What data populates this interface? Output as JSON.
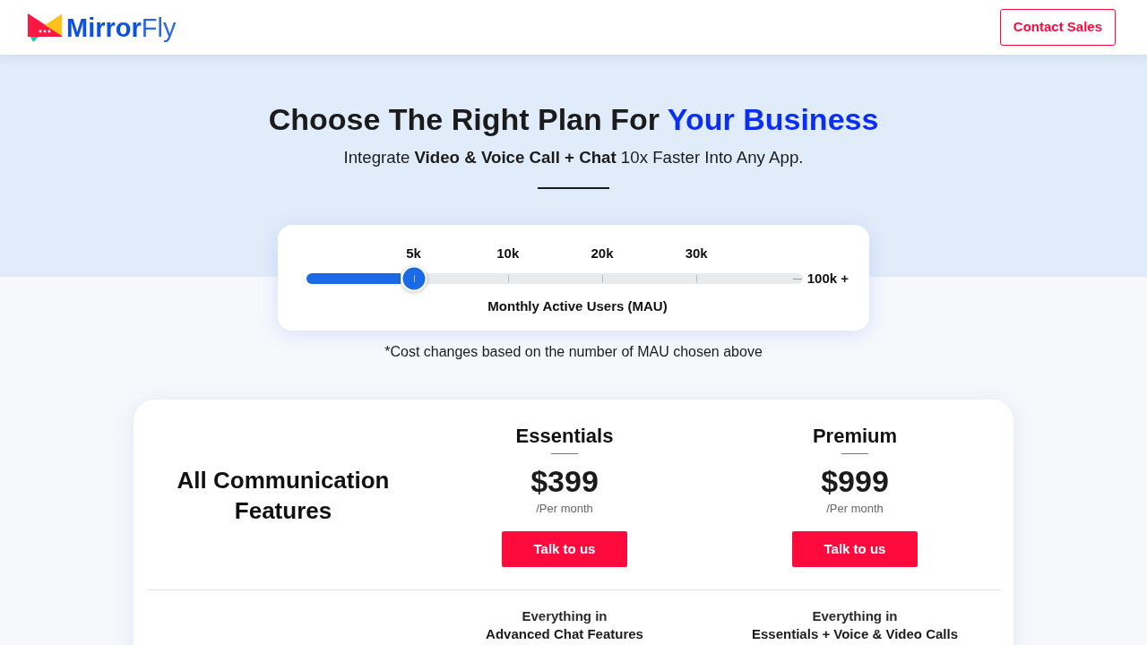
{
  "header": {
    "logo": {
      "wordmark": "**Mirror**Fly"
    },
    "contact_button": "Contact Sales"
  },
  "hero": {
    "title": "Choose The Right Plan For",
    "title_highlight": "Your Business",
    "subtitle": "Integrate **Video & Voice Call + Chat** 10x Faster Into Any App."
  },
  "mau_slider": {
    "ticks": [
      "5k",
      "10k",
      "20k",
      "30k"
    ],
    "level": 0.216,
    "max_label": "100k +",
    "label": "Monthly Active Users (MAU)"
  },
  "cost_note": "*Cost changes based on the number of MAU chosen above",
  "pricing": {
    "heading": "All Communication Features",
    "plans": [
      {
        "name": "Essentials",
        "price": "$399",
        "period": "/Per month",
        "button": "Talk to us",
        "includes_lead": "Everything in",
        "includes": "Advanced Chat Features"
      },
      {
        "name": "Premium",
        "price": "$999",
        "period": "/Per month",
        "button": "Talk to us",
        "includes_lead": "Everything in",
        "includes": "Essentials + Voice & Video Calls"
      }
    ]
  }
}
